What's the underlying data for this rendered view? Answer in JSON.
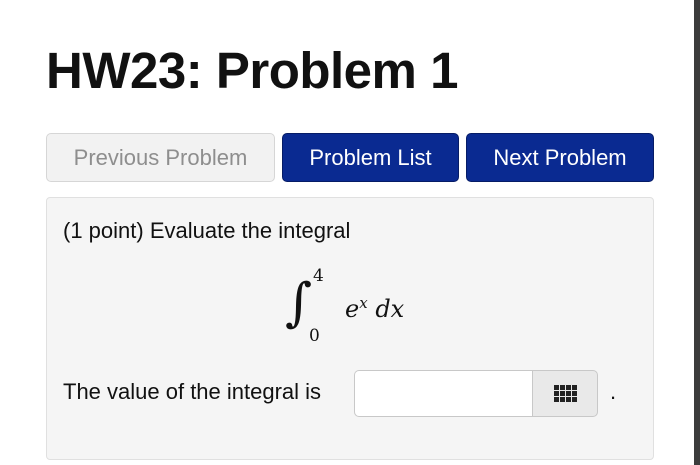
{
  "page": {
    "title": "HW23: Problem 1"
  },
  "nav": {
    "previous_label": "Previous Problem",
    "list_label": "Problem List",
    "next_label": "Next Problem"
  },
  "problem": {
    "prompt": "(1 point) Evaluate the integral",
    "integral": {
      "symbol": "∫",
      "upper_limit": "4",
      "lower_limit": "0",
      "base": "e",
      "exponent": "x",
      "differential": "dx"
    },
    "answer_label": "The value of the integral is",
    "answer_value": "",
    "answer_trailing": "."
  },
  "icons": {
    "keypad": "keypad-grid-icon"
  },
  "colors": {
    "primary_button": "#0a2a91",
    "disabled_button": "#f2f2f2",
    "panel_background": "#f5f5f5"
  }
}
